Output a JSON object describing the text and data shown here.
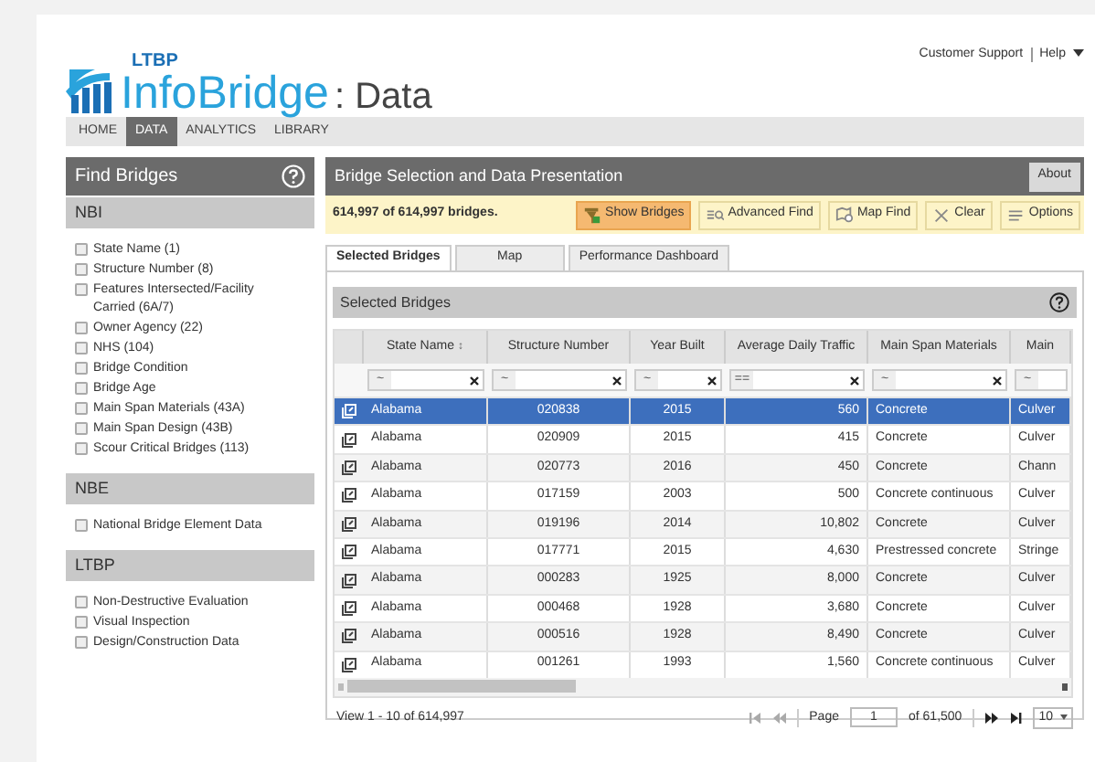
{
  "header": {
    "logo_small": "LTBP",
    "logo_main": "InfoBridge",
    "logo_suffix": ": Data",
    "links": [
      "Customer Support",
      "Help"
    ]
  },
  "nav": [
    {
      "label": "HOME",
      "selected": false
    },
    {
      "label": "DATA",
      "selected": true
    },
    {
      "label": "ANALYTICS",
      "selected": false
    },
    {
      "label": "LIBRARY",
      "selected": false
    }
  ],
  "sidebar": {
    "title": "Find Bridges",
    "sections": [
      {
        "title": "NBI",
        "items": [
          {
            "label": "State Name (1)",
            "checked": false
          },
          {
            "label": "Structure Number (8)",
            "checked": false
          },
          {
            "label": "Features Intersected/Facility Carried (6A/7)",
            "checked": false
          },
          {
            "label": "Owner Agency (22)",
            "checked": false
          },
          {
            "label": "NHS (104)",
            "checked": false
          },
          {
            "label": "Bridge Condition",
            "checked": false
          },
          {
            "label": "Bridge Age",
            "checked": false
          },
          {
            "label": "Main Span Materials (43A)",
            "checked": false
          },
          {
            "label": "Main Span Design (43B)",
            "checked": false
          },
          {
            "label": "Scour Critical Bridges (113)",
            "checked": false
          }
        ]
      },
      {
        "title": "NBE",
        "items": [
          {
            "label": "National Bridge Element Data",
            "checked": false
          }
        ]
      },
      {
        "title": "LTBP",
        "items": [
          {
            "label": "Non-Destructive Evaluation",
            "checked": false
          },
          {
            "label": "Visual Inspection",
            "checked": false
          },
          {
            "label": "Design/Construction Data",
            "checked": false
          }
        ]
      }
    ]
  },
  "main": {
    "title": "Bridge Selection and Data Presentation",
    "about": "About",
    "count": "614,997 of 614,997 bridges.",
    "toolbar": [
      {
        "label": "Show Bridges",
        "kind": "show",
        "selected": true
      },
      {
        "label": "Advanced Find",
        "kind": "advanced",
        "selected": false
      },
      {
        "label": "Map Find",
        "kind": "map",
        "selected": false
      },
      {
        "label": "Clear",
        "kind": "clear",
        "selected": false
      },
      {
        "label": "Options",
        "kind": "options",
        "selected": false
      }
    ],
    "tabs": [
      {
        "label": "Selected Bridges",
        "selected": true
      },
      {
        "label": "Map",
        "selected": false
      },
      {
        "label": "Performance Dashboard",
        "selected": false
      }
    ]
  },
  "table": {
    "title": "Selected Bridges",
    "columns": [
      {
        "label": "State Name",
        "sort": "↕",
        "filter": "~"
      },
      {
        "label": "Structure Number",
        "filter": "~"
      },
      {
        "label": "Year Built",
        "filter": "~"
      },
      {
        "label": "Average Daily Traffic",
        "filter": "=="
      },
      {
        "label": "Main Span Materials",
        "filter": "~"
      },
      {
        "label": "Main",
        "filter": "~"
      }
    ],
    "rows": [
      {
        "selected": true,
        "cells": [
          "Alabama",
          "020838",
          "2015",
          "560",
          "Concrete",
          "Culver"
        ]
      },
      {
        "selected": false,
        "cells": [
          "Alabama",
          "020909",
          "2015",
          "415",
          "Concrete",
          "Culver"
        ]
      },
      {
        "selected": false,
        "cells": [
          "Alabama",
          "020773",
          "2016",
          "450",
          "Concrete",
          "Chann"
        ]
      },
      {
        "selected": false,
        "cells": [
          "Alabama",
          "017159",
          "2003",
          "500",
          "Concrete continuous",
          "Culver"
        ]
      },
      {
        "selected": false,
        "cells": [
          "Alabama",
          "019196",
          "2014",
          "10,802",
          "Concrete",
          "Culver"
        ]
      },
      {
        "selected": false,
        "cells": [
          "Alabama",
          "017771",
          "2015",
          "4,630",
          "Prestressed concrete",
          "Stringe"
        ]
      },
      {
        "selected": false,
        "cells": [
          "Alabama",
          "000283",
          "1925",
          "8,000",
          "Concrete",
          "Culver"
        ]
      },
      {
        "selected": false,
        "cells": [
          "Alabama",
          "000468",
          "1928",
          "3,680",
          "Concrete",
          "Culver"
        ]
      },
      {
        "selected": false,
        "cells": [
          "Alabama",
          "000516",
          "1928",
          "8,490",
          "Concrete",
          "Culver"
        ]
      },
      {
        "selected": false,
        "cells": [
          "Alabama",
          "001261",
          "1993",
          "1,560",
          "Concrete continuous",
          "Culver"
        ]
      }
    ],
    "footer": {
      "view": "View 1 - 10 of 614,997",
      "page_label": "Page",
      "page": "1",
      "of": "of 61,500",
      "page_size": "10"
    }
  }
}
